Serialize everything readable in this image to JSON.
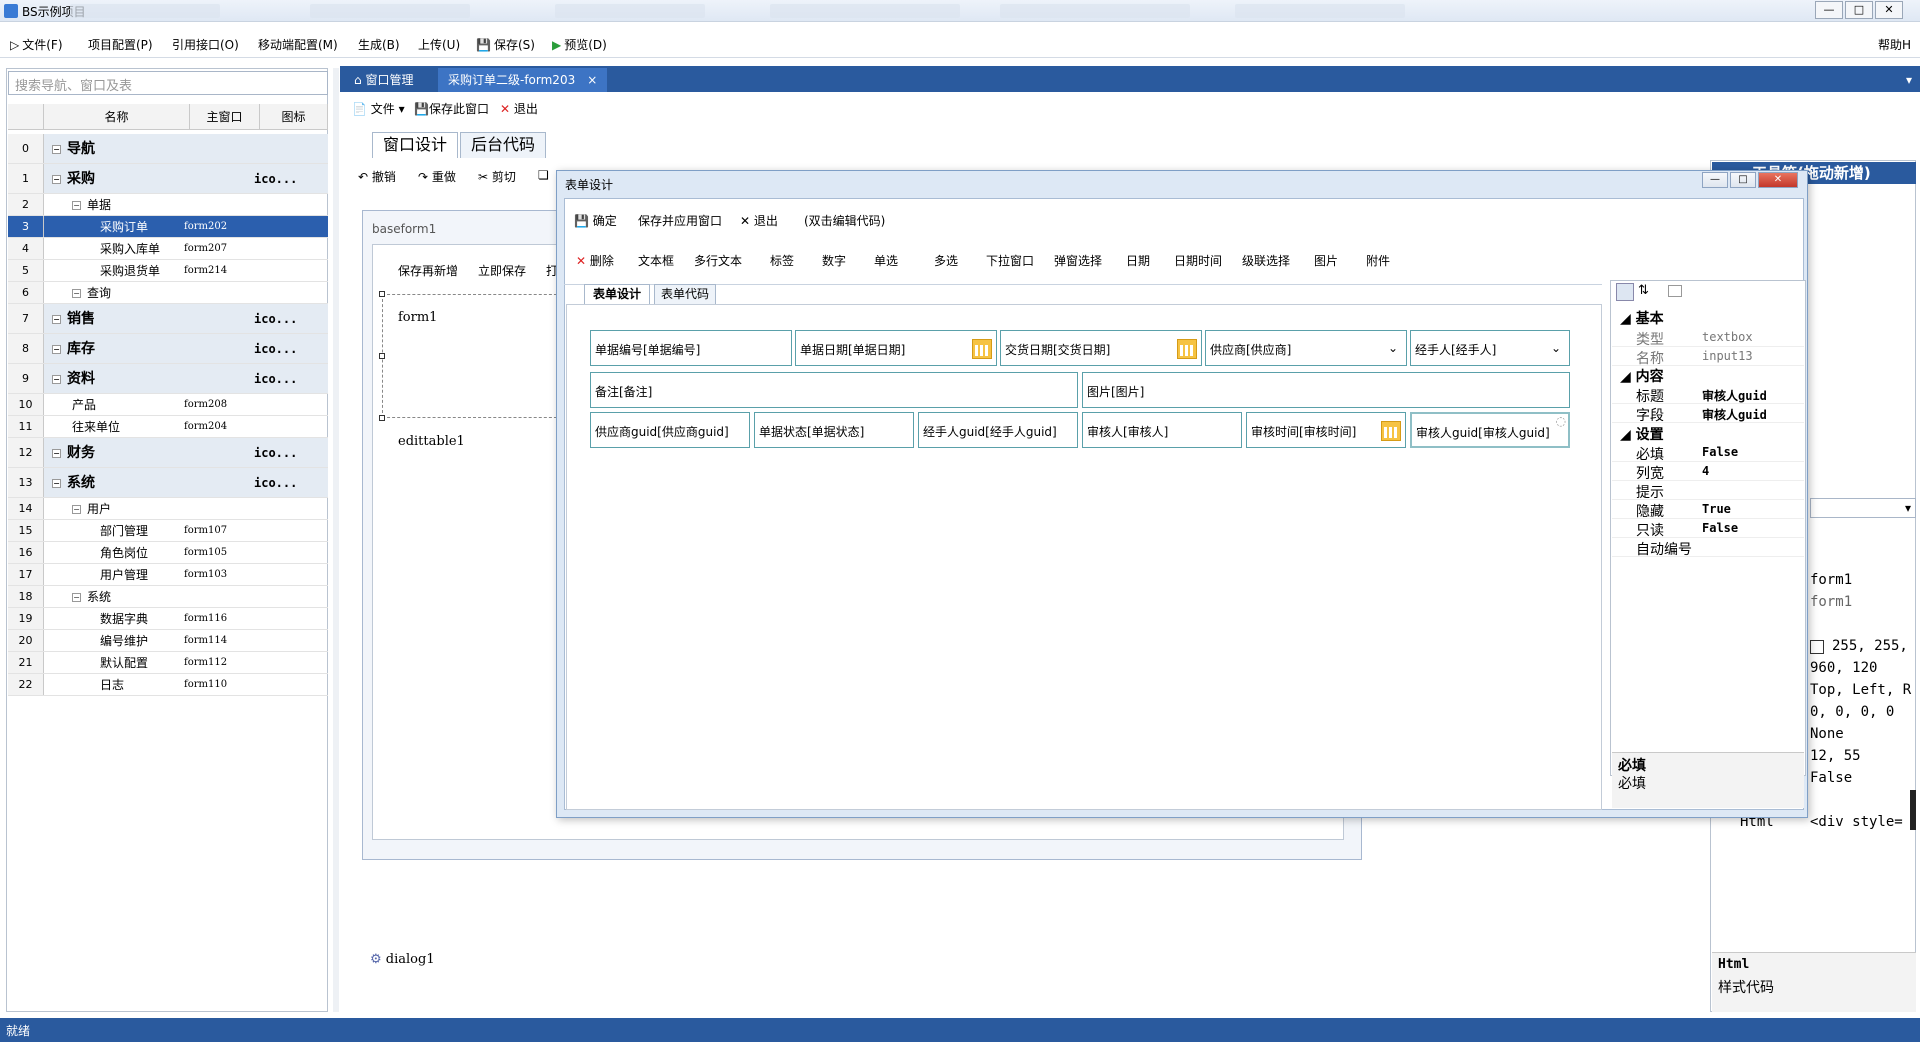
{
  "app": {
    "title": "BS示例项目",
    "help": "帮助H"
  },
  "menu": {
    "items": [
      "文件(F)",
      "项目配置(P)",
      "引用接口(O)",
      "移动端配置(M)",
      "生成(B)",
      "上传(U)",
      "保存(S)",
      "预览(D)"
    ]
  },
  "nav": {
    "search_placeholder": "搜索导航、窗口及表",
    "columns": [
      "名称",
      "主窗口",
      "图标"
    ],
    "rows": [
      {
        "num": "0",
        "name": "导航",
        "code": "",
        "icon": ""
      },
      {
        "num": "1",
        "name": "采购",
        "code": "",
        "icon": "ico..."
      },
      {
        "num": "2",
        "name": "单据",
        "code": "",
        "icon": ""
      },
      {
        "num": "3",
        "name": "采购订单",
        "code": "form202",
        "icon": ""
      },
      {
        "num": "4",
        "name": "采购入库单",
        "code": "form207",
        "icon": ""
      },
      {
        "num": "5",
        "name": "采购退货单",
        "code": "form214",
        "icon": ""
      },
      {
        "num": "6",
        "name": "查询",
        "code": "",
        "icon": ""
      },
      {
        "num": "7",
        "name": "销售",
        "code": "",
        "icon": "ico..."
      },
      {
        "num": "8",
        "name": "库存",
        "code": "",
        "icon": "ico..."
      },
      {
        "num": "9",
        "name": "资料",
        "code": "",
        "icon": "ico..."
      },
      {
        "num": "10",
        "name": "产品",
        "code": "form208",
        "icon": ""
      },
      {
        "num": "11",
        "name": "往来单位",
        "code": "form204",
        "icon": ""
      },
      {
        "num": "12",
        "name": "财务",
        "code": "",
        "icon": "ico..."
      },
      {
        "num": "13",
        "name": "系统",
        "code": "",
        "icon": "ico..."
      },
      {
        "num": "14",
        "name": "用户",
        "code": "",
        "icon": ""
      },
      {
        "num": "15",
        "name": "部门管理",
        "code": "form107",
        "icon": ""
      },
      {
        "num": "16",
        "name": "角色岗位",
        "code": "form105",
        "icon": ""
      },
      {
        "num": "17",
        "name": "用户管理",
        "code": "form103",
        "icon": ""
      },
      {
        "num": "18",
        "name": "系统",
        "code": "",
        "icon": ""
      },
      {
        "num": "19",
        "name": "数据字典",
        "code": "form116",
        "icon": ""
      },
      {
        "num": "20",
        "name": "编号维护",
        "code": "form114",
        "icon": ""
      },
      {
        "num": "21",
        "name": "默认配置",
        "code": "form112",
        "icon": ""
      },
      {
        "num": "22",
        "name": "日志",
        "code": "form110",
        "icon": ""
      }
    ]
  },
  "tabs": {
    "window_manage": "窗口管理",
    "active_doc": "采购订单二级-form203"
  },
  "main_toolbar": {
    "file": "文件",
    "save_window": "保存此窗口",
    "exit": "退出"
  },
  "subtabs": {
    "design": "窗口设计",
    "backend": "后台代码"
  },
  "edit_toolbar": {
    "undo": "撤销",
    "redo": "重做",
    "cut": "剪切"
  },
  "canvas": {
    "baseform": "baseform1",
    "save_new": "保存再新增",
    "save_now": "立即保存",
    "print_cut": "打",
    "form1": "form1",
    "edittable": "edittable1",
    "dialog1": "dialog1"
  },
  "right_panel": {
    "header": "工具箱(拖动新增)",
    "values": [
      "form1",
      "form1",
      "255, 255,",
      "960, 120",
      "Top, Left, R",
      "0, 0, 0, 0",
      "None",
      "12, 55",
      "False"
    ],
    "html_key": "Html",
    "html_val": "<div style=",
    "desc_title": "Html",
    "desc_text": "样式代码"
  },
  "dialog": {
    "title": "表单设计",
    "toolbar": {
      "ok": "确定",
      "save_apply": "保存并应用窗口",
      "exit": "退出",
      "hint": "(双击编辑代码)"
    },
    "widgets": [
      "删除",
      "文本框",
      "多行文本",
      "标签",
      "数字",
      "单选",
      "多选",
      "下拉窗口",
      "弹窗选择",
      "日期",
      "日期时间",
      "级联选择",
      "图片",
      "附件"
    ],
    "tabs": {
      "design": "表单设计",
      "code": "表单代码"
    },
    "fields": {
      "row1": [
        "单据编号[单据编号]",
        "单据日期[单据日期]",
        "交货日期[交货日期]",
        "供应商[供应商]",
        "经手人[经手人]"
      ],
      "row2": [
        "备注[备注]",
        "图片[图片]"
      ],
      "row3": [
        "供应商guid[供应商guid]",
        "单据状态[单据状态]",
        "经手人guid[经手人guid]",
        "审核人[审核人]",
        "审核时间[审核时间]",
        "审核人guid[审核人guid]"
      ]
    }
  },
  "props": {
    "cat_basic": "基本",
    "cat_content": "内容",
    "cat_settings": "设置",
    "basic": [
      {
        "k": "类型",
        "v": "textbox"
      },
      {
        "k": "名称",
        "v": "input13"
      }
    ],
    "content": [
      {
        "k": "标题",
        "v": "审核人guid"
      },
      {
        "k": "字段",
        "v": "审核人guid"
      }
    ],
    "settings": [
      {
        "k": "必填",
        "v": "False"
      },
      {
        "k": "列宽",
        "v": "4"
      },
      {
        "k": "提示",
        "v": ""
      },
      {
        "k": "隐藏",
        "v": "True"
      },
      {
        "k": "只读",
        "v": "False"
      },
      {
        "k": "自动编号",
        "v": ""
      }
    ],
    "desc_title": "必填",
    "desc_text": "必填"
  },
  "status": {
    "text": "就绪"
  },
  "colors": {
    "accent": "#2a5a9e",
    "selection": "#2b5fae",
    "field_border": "#5aa0aa"
  }
}
